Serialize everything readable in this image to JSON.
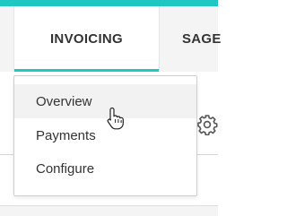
{
  "header": {
    "accent_color": "#1fc7c2",
    "tabs": [
      {
        "label": "INVOICING",
        "active": true
      },
      {
        "label": "SAGE"
      }
    ]
  },
  "dropdown": {
    "items": [
      {
        "label": "Overview",
        "hovered": true
      },
      {
        "label": "Payments"
      },
      {
        "label": "Configure"
      }
    ]
  },
  "icons": {
    "settings": "gear-icon",
    "pointer": "hand-pointer-icon"
  }
}
